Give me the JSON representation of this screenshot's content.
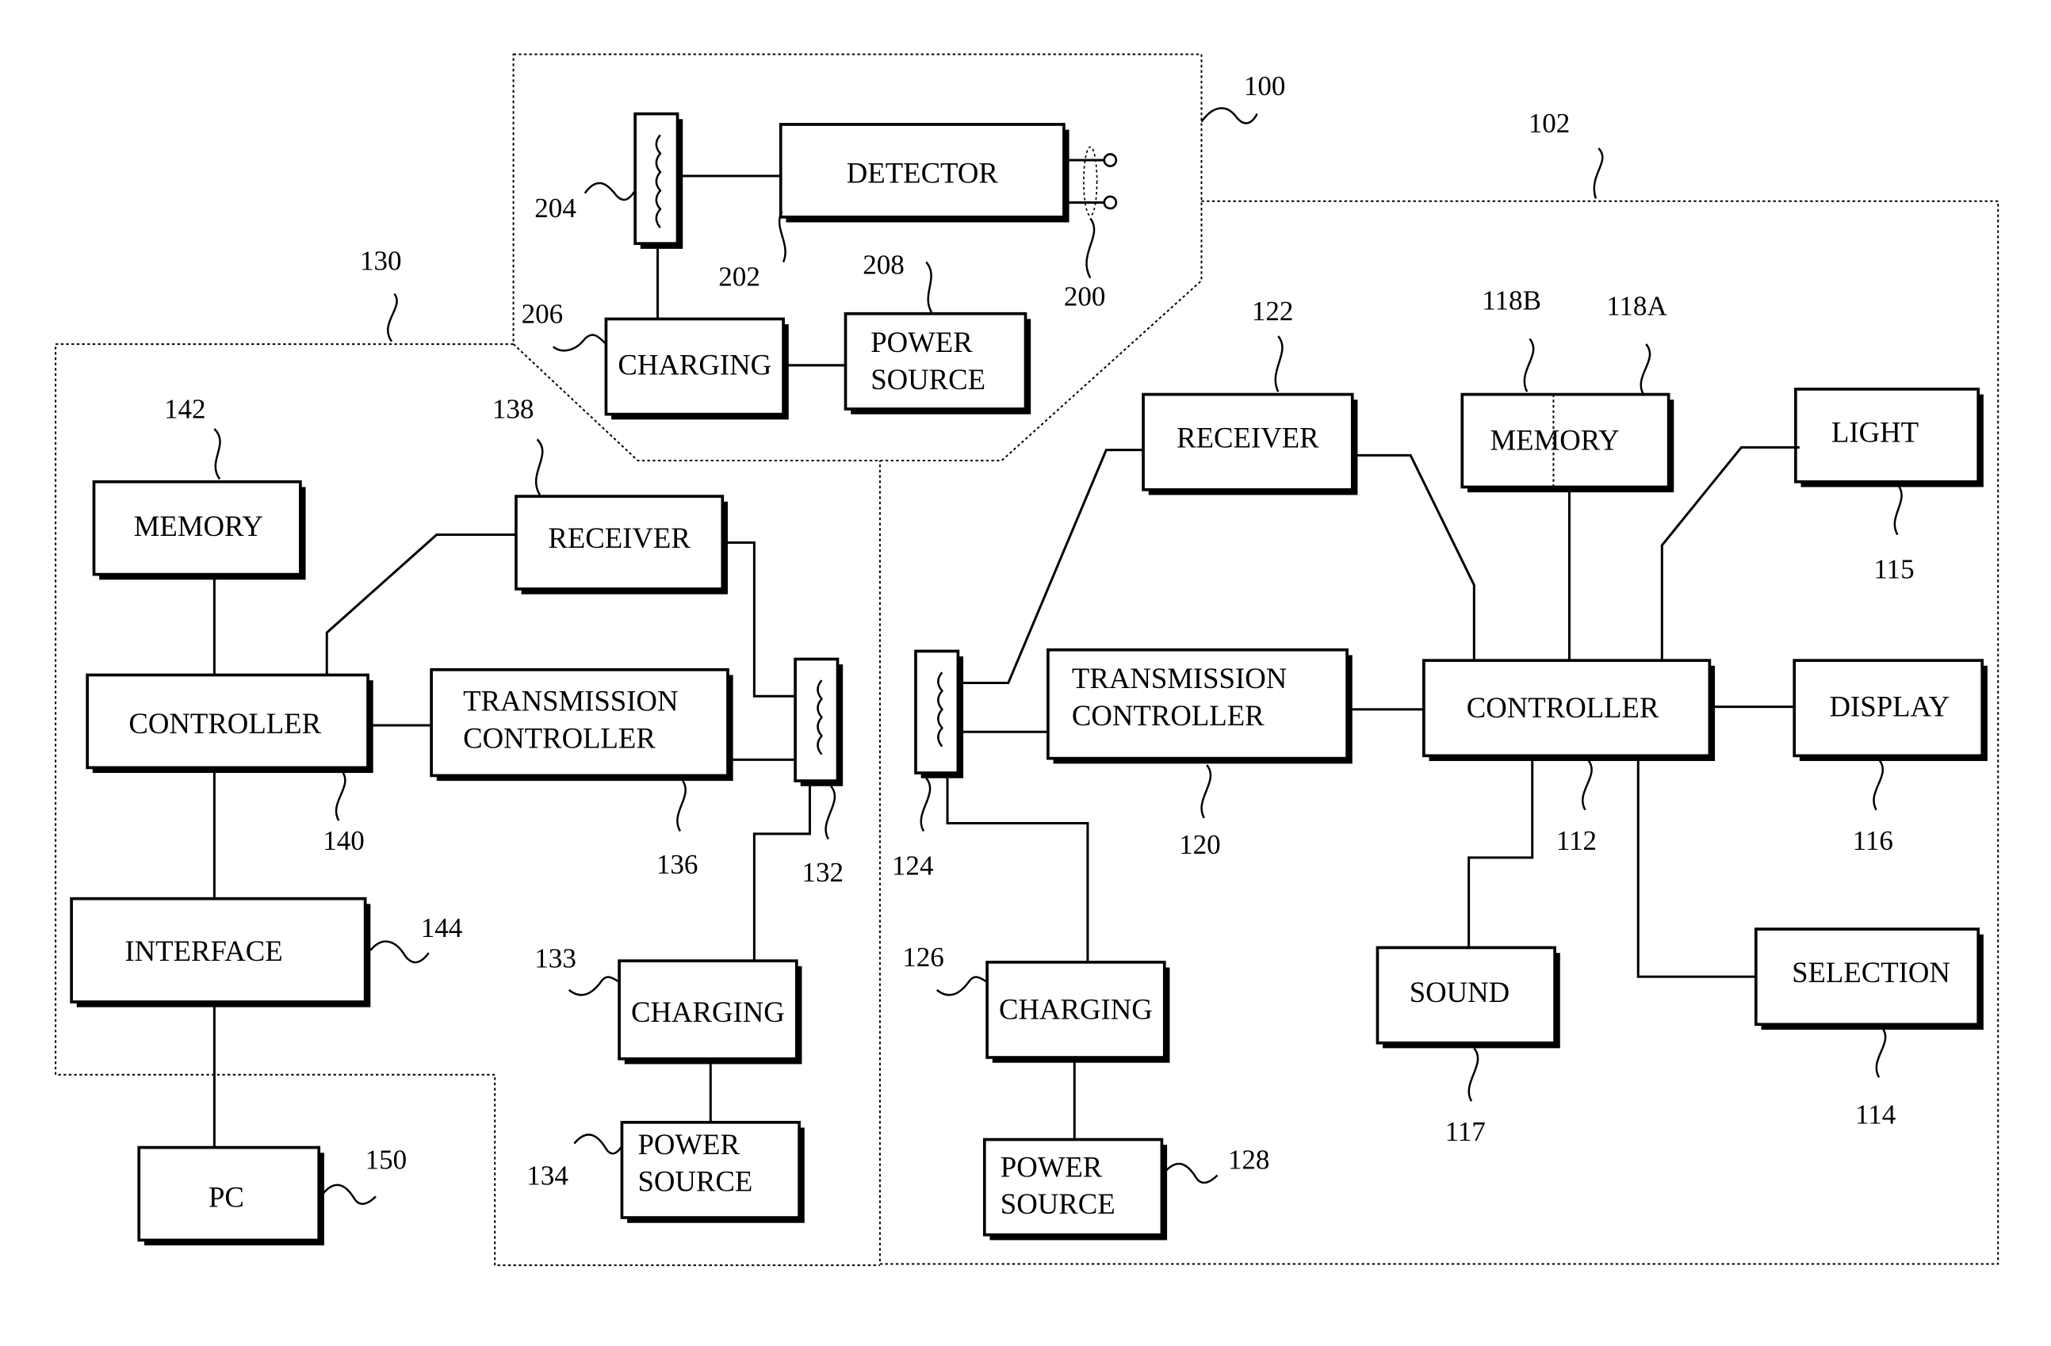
{
  "figure": {
    "type": "block-diagram",
    "regions": [
      {
        "id": "100",
        "label": "100"
      },
      {
        "id": "102",
        "label": "102"
      },
      {
        "id": "130",
        "label": "130"
      }
    ],
    "blocks": {
      "detector": {
        "lines": [
          "DETECTOR"
        ],
        "ref": "202"
      },
      "coil_204": {
        "lines": [],
        "ref": "204"
      },
      "terminals": {
        "ref": "200"
      },
      "charging_206": {
        "lines": [
          "CHARGING"
        ],
        "ref": "206"
      },
      "power_208": {
        "lines": [
          "POWER",
          "SOURCE"
        ],
        "ref": "208"
      },
      "memory_142": {
        "lines": [
          "MEMORY"
        ],
        "ref": "142"
      },
      "receiver_138": {
        "lines": [
          "RECEIVER"
        ],
        "ref": "138"
      },
      "controller_140": {
        "lines": [
          "CONTROLLER"
        ],
        "ref": "140"
      },
      "txctrl_136": {
        "lines": [
          "TRANSMISSION",
          "CONTROLLER"
        ],
        "ref": "136"
      },
      "coil_132": {
        "lines": [],
        "ref": "132"
      },
      "interface_144": {
        "lines": [
          "INTERFACE"
        ],
        "ref": "144"
      },
      "charging_133": {
        "lines": [
          "CHARGING"
        ],
        "ref": "133"
      },
      "power_134": {
        "lines": [
          "POWER",
          "SOURCE"
        ],
        "ref": "134"
      },
      "pc_150": {
        "lines": [
          "PC"
        ],
        "ref": "150"
      },
      "receiver_122": {
        "lines": [
          "RECEIVER"
        ],
        "ref": "122"
      },
      "memory_118": {
        "lines": [
          "MEMORY"
        ],
        "ref_b": "118B",
        "ref_a": "118A"
      },
      "light_115": {
        "lines": [
          "LIGHT"
        ],
        "ref": "115"
      },
      "coil_124": {
        "lines": [],
        "ref": "124"
      },
      "txctrl_120": {
        "lines": [
          "TRANSMISSION",
          "CONTROLLER"
        ],
        "ref": "120"
      },
      "controller_112": {
        "lines": [
          "CONTROLLER"
        ],
        "ref": "112"
      },
      "display_116": {
        "lines": [
          "DISPLAY"
        ],
        "ref": "116"
      },
      "charging_126": {
        "lines": [
          "CHARGING"
        ],
        "ref": "126"
      },
      "power_128": {
        "lines": [
          "POWER",
          "SOURCE"
        ],
        "ref": "128"
      },
      "sound_117": {
        "lines": [
          "SOUND"
        ],
        "ref": "117"
      },
      "selection_114": {
        "lines": [
          "SELECTION"
        ],
        "ref": "114"
      }
    }
  }
}
